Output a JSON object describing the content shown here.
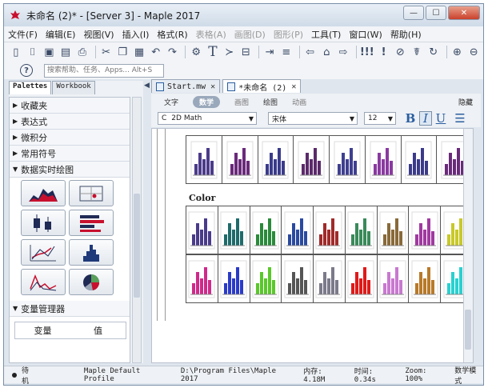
{
  "window": {
    "title": "未命名 (2)* - [Server 3] - Maple 2017",
    "controls": {
      "minimize": "—",
      "maximize": "☐",
      "close": "✕"
    }
  },
  "menubar": [
    {
      "label": "文件(F)",
      "enabled": true
    },
    {
      "label": "编辑(E)",
      "enabled": true
    },
    {
      "label": "视图(V)",
      "enabled": true
    },
    {
      "label": "插入(I)",
      "enabled": true
    },
    {
      "label": "格式(R)",
      "enabled": true
    },
    {
      "label": "表格(A)",
      "enabled": false
    },
    {
      "label": "画图(D)",
      "enabled": false
    },
    {
      "label": "图形(P)",
      "enabled": false
    },
    {
      "label": "工具(T)",
      "enabled": true
    },
    {
      "label": "窗口(W)",
      "enabled": true
    },
    {
      "label": "帮助(H)",
      "enabled": true
    }
  ],
  "toolbar": {
    "search_placeholder": "搜索帮助、任务、Apps... Alt+S",
    "icons": [
      "new-document-icon",
      "open-icon",
      "save-icon",
      "save-as-icon",
      "print-icon",
      "cut-icon",
      "copy-icon",
      "paste-icon",
      "undo-icon",
      "redo-icon",
      "math-icon",
      "text-icon",
      "arrow-icon",
      "table-icon",
      "indent-icon",
      "outdent-icon",
      "back-icon",
      "home-icon",
      "forward-icon",
      "execute-all-icon",
      "execute-icon",
      "stop-icon",
      "debug-icon",
      "restart-icon",
      "zoom-in-icon",
      "zoom-out-icon"
    ]
  },
  "palette_panel": {
    "tabs": [
      {
        "label": "Palettes",
        "active": true
      },
      {
        "label": "Workbook",
        "active": false
      }
    ],
    "sections": [
      {
        "label": "收藏夹",
        "expanded": false
      },
      {
        "label": "表达式",
        "expanded": false
      },
      {
        "label": "微积分",
        "expanded": false
      },
      {
        "label": "常用符号",
        "expanded": false
      },
      {
        "label": "数据实时绘图",
        "expanded": true
      }
    ],
    "var_manager": {
      "label": "变量管理器",
      "col_variable": "变量",
      "col_value": "值"
    }
  },
  "doc_tabs": [
    {
      "label": "Start.mw",
      "active": false
    },
    {
      "label": "*未命名 (2)",
      "active": true
    }
  ],
  "context_bar": {
    "modes": [
      {
        "label": "文字",
        "state": "normal"
      },
      {
        "label": "数学",
        "state": "active"
      },
      {
        "label": "画图",
        "state": "dim"
      },
      {
        "label": "绘图",
        "state": "normal"
      },
      {
        "label": "动画",
        "state": "dim"
      }
    ],
    "hide_label": "隐藏"
  },
  "format_bar": {
    "style_prefix": "C",
    "style": "2D Math",
    "font": "宋体",
    "size": "12",
    "bold": "B",
    "italic": "I",
    "underline": "U"
  },
  "document": {
    "color_label": "Color",
    "bar_colors_row1": [
      "#4b3b8a",
      "#6a2a7a",
      "#3b3b8a",
      "#5a2a6a",
      "#3f3f8f",
      "#8a3aa0",
      "#3b3b8a",
      "#6a2a7a"
    ],
    "bar_colors_row2": [
      "#4b3b8a",
      "#1f6b6b",
      "#2a8a3a",
      "#2a4aa0",
      "#a02a2a",
      "#3a8a5a",
      "#8a6a3a",
      "#a03aa0",
      "#c8c82a"
    ],
    "bar_colors_row3": [
      "#d02a8a",
      "#2a3ac8",
      "#5ac82a",
      "#555555",
      "#7a7a8a",
      "#e01a1a",
      "#c878d0",
      "#b87a2a",
      "#2ad0d0"
    ]
  },
  "statusbar": {
    "status": "待机",
    "profile": "Maple Default Profile",
    "path": "D:\\Program Files\\Maple 2017",
    "memory": "内存: 4.18M",
    "time": "时间: 0.34s",
    "zoom": "Zoom: 100%",
    "mode": "数学模式"
  }
}
